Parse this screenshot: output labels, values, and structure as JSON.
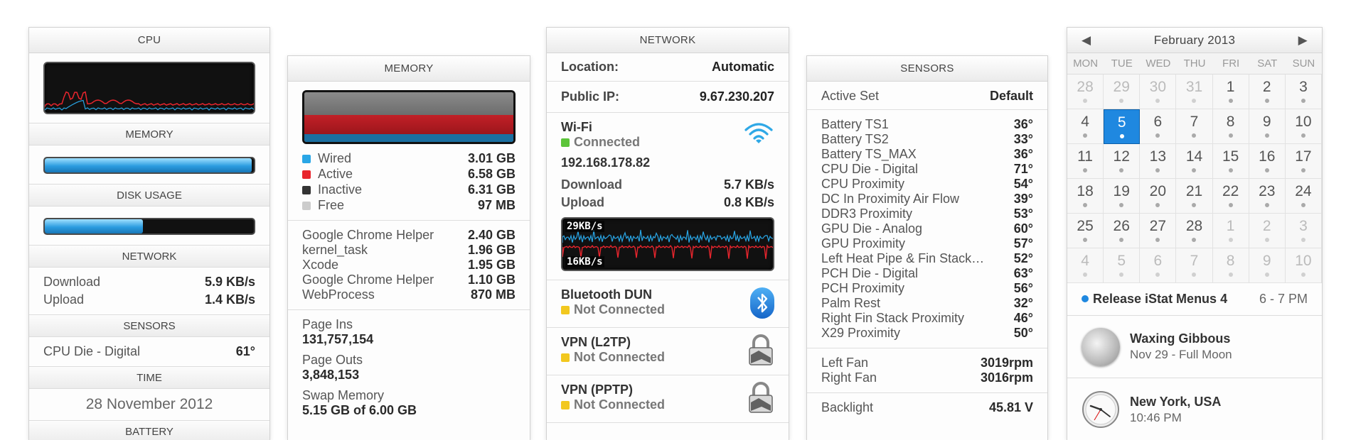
{
  "cpu_panel": {
    "title": "CPU",
    "memory_label": "MEMORY",
    "memory_fill": 0.99,
    "disk_label": "DISK USAGE",
    "disk_fill": 0.47,
    "network_label": "NETWORK",
    "download_label": "Download",
    "download_value": "5.9 KB/s",
    "upload_label": "Upload",
    "upload_value": "1.4 KB/s",
    "sensors_label": "SENSORS",
    "sensor_name": "CPU Die - Digital",
    "sensor_value": "61°",
    "time_label": "TIME",
    "date": "28 November 2012",
    "battery_label": "BATTERY"
  },
  "memory_panel": {
    "title": "MEMORY",
    "legend": [
      {
        "label": "Wired",
        "value": "3.01 GB",
        "color": "#29a6e6"
      },
      {
        "label": "Active",
        "value": "6.58 GB",
        "color": "#e8252d"
      },
      {
        "label": "Inactive",
        "value": "6.31 GB",
        "color": "#333333"
      },
      {
        "label": "Free",
        "value": "97 MB",
        "color": "#cccccc"
      }
    ],
    "processes": [
      {
        "name": "Google Chrome Helper",
        "value": "2.40 GB"
      },
      {
        "name": "kernel_task",
        "value": "1.96 GB"
      },
      {
        "name": "Xcode",
        "value": "1.95 GB"
      },
      {
        "name": "Google Chrome Helper",
        "value": "1.10 GB"
      },
      {
        "name": "WebProcess",
        "value": "870 MB"
      }
    ],
    "page_ins_label": "Page Ins",
    "page_ins_value": "131,757,154",
    "page_outs_label": "Page Outs",
    "page_outs_value": "3,848,153",
    "swap_label": "Swap Memory",
    "swap_value": "5.15 GB of 6.00 GB"
  },
  "network_panel": {
    "title": "NETWORK",
    "location_label": "Location:",
    "location_value": "Automatic",
    "public_ip_label": "Public IP:",
    "public_ip_value": "9.67.230.207",
    "wifi_title": "Wi-Fi",
    "wifi_status": "Connected",
    "wifi_status_color": "#5cc43a",
    "local_ip": "192.168.178.82",
    "download_label": "Download",
    "download_value": "5.7 KB/s",
    "upload_label": "Upload",
    "upload_value": "0.8 KB/s",
    "graph_top_label": "29KB/s",
    "graph_bottom_label": "16KB/s",
    "bluetooth_title": "Bluetooth DUN",
    "bluetooth_status": "Not Connected",
    "vpn_l2tp_title": "VPN (L2TP)",
    "vpn_l2tp_status": "Not Connected",
    "vpn_pptp_title": "VPN (PPTP)",
    "vpn_pptp_status": "Not Connected",
    "not_connected_color": "#f2c81f"
  },
  "sensors_panel": {
    "title": "SENSORS",
    "active_set_label": "Active Set",
    "active_set_value": "Default",
    "sensors": [
      {
        "name": "Battery TS1",
        "value": "36°"
      },
      {
        "name": "Battery TS2",
        "value": "33°"
      },
      {
        "name": "Battery TS_MAX",
        "value": "36°"
      },
      {
        "name": "CPU Die - Digital",
        "value": "71°"
      },
      {
        "name": "CPU Proximity",
        "value": "54°"
      },
      {
        "name": "DC In Proximity Air Flow",
        "value": "39°"
      },
      {
        "name": "DDR3 Proximity",
        "value": "53°"
      },
      {
        "name": "GPU Die - Analog",
        "value": "60°"
      },
      {
        "name": "GPU Proximity",
        "value": "57°"
      },
      {
        "name": "Left Heat Pipe & Fin Stack…",
        "value": "52°"
      },
      {
        "name": "PCH Die - Digital",
        "value": "63°"
      },
      {
        "name": "PCH Proximity",
        "value": "56°"
      },
      {
        "name": "Palm Rest",
        "value": "32°"
      },
      {
        "name": "Right Fin Stack Proximity",
        "value": "46°"
      },
      {
        "name": "X29 Proximity",
        "value": "50°"
      }
    ],
    "fans": [
      {
        "name": "Left Fan",
        "value": "3019rpm"
      },
      {
        "name": "Right Fan",
        "value": "3016rpm"
      }
    ],
    "backlight_label": "Backlight",
    "backlight_value": "45.81 V"
  },
  "calendar_panel": {
    "month_title": "February 2013",
    "prev_icon": "◀",
    "next_icon": "▶",
    "weekdays": [
      "MON",
      "TUE",
      "WED",
      "THU",
      "FRI",
      "SAT",
      "SUN"
    ],
    "days": [
      {
        "d": "28",
        "other": true
      },
      {
        "d": "29",
        "other": true
      },
      {
        "d": "30",
        "other": true
      },
      {
        "d": "31",
        "other": true
      },
      {
        "d": "1"
      },
      {
        "d": "2"
      },
      {
        "d": "3"
      },
      {
        "d": "4"
      },
      {
        "d": "5",
        "today": true
      },
      {
        "d": "6"
      },
      {
        "d": "7"
      },
      {
        "d": "8"
      },
      {
        "d": "9"
      },
      {
        "d": "10"
      },
      {
        "d": "11"
      },
      {
        "d": "12"
      },
      {
        "d": "13"
      },
      {
        "d": "14"
      },
      {
        "d": "15"
      },
      {
        "d": "16"
      },
      {
        "d": "17"
      },
      {
        "d": "18"
      },
      {
        "d": "19"
      },
      {
        "d": "20"
      },
      {
        "d": "21"
      },
      {
        "d": "22"
      },
      {
        "d": "23"
      },
      {
        "d": "24"
      },
      {
        "d": "25"
      },
      {
        "d": "26"
      },
      {
        "d": "27"
      },
      {
        "d": "28"
      },
      {
        "d": "1",
        "other": true
      },
      {
        "d": "2",
        "other": true
      },
      {
        "d": "3",
        "other": true
      },
      {
        "d": "4",
        "other": true
      },
      {
        "d": "5",
        "other": true
      },
      {
        "d": "6",
        "other": true
      },
      {
        "d": "7",
        "other": true
      },
      {
        "d": "8",
        "other": true
      },
      {
        "d": "9",
        "other": true
      },
      {
        "d": "10",
        "other": true
      }
    ],
    "event_title": "Release iStat Menus 4",
    "event_time": "6 - 7 PM",
    "event_color": "#1f88e0",
    "moon_title": "Waxing Gibbous",
    "moon_sub": "Nov 29 - Full Moon",
    "clock_title": "New York, USA",
    "clock_time": "10:46 PM"
  }
}
